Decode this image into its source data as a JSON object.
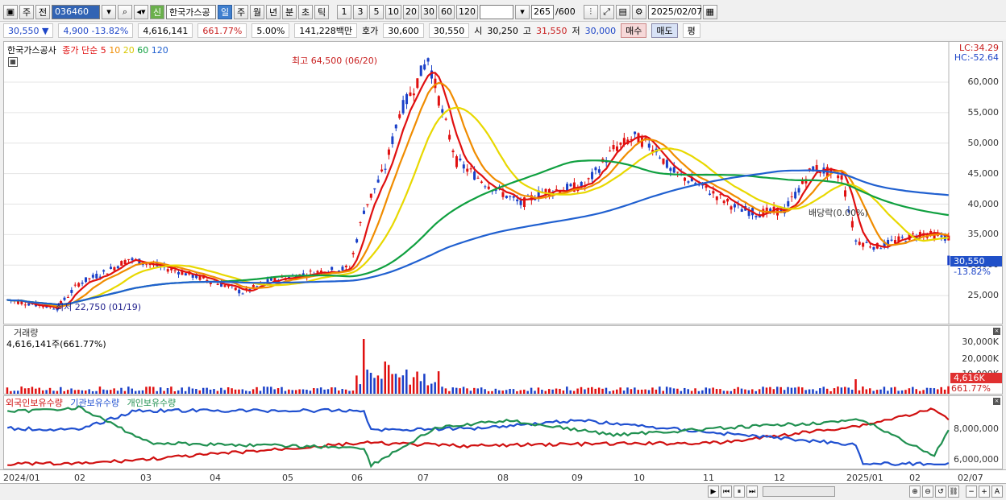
{
  "toolbar": {
    "period": "주",
    "prev": "전",
    "code": "036460",
    "name": "한국가스공",
    "credit": "신",
    "tabs": [
      "일",
      "주",
      "월",
      "년",
      "분",
      "초",
      "틱"
    ],
    "nums": [
      "1",
      "3",
      "5",
      "10",
      "20",
      "30",
      "60",
      "120"
    ],
    "count": "265",
    "count_total": "/600",
    "date": "2025/02/07"
  },
  "info": {
    "price": "30,550",
    "arrow": "▼",
    "change": "4,900",
    "rate": "-13.82%",
    "volume": "4,616,141",
    "vol_rate": "661.77%",
    "pct": "5.00%",
    "amount": "141,228백만",
    "ask_label": "호가",
    "ask1": "30,600",
    "ask2": "30,550",
    "open_label": "시",
    "open": "30,250",
    "high_label": "고",
    "high": "31,550",
    "low_label": "저",
    "low": "30,000",
    "buy": "매수",
    "sell": "매도",
    "eval": "평"
  },
  "price_panel": {
    "name": "한국가스공사",
    "legend_title": "종가 단순",
    "ma": [
      "5",
      "10",
      "20",
      "60",
      "120"
    ],
    "ma_colors": [
      "#e01010",
      "#f08c00",
      "#e8d800",
      "#10a040",
      "#2060d0"
    ],
    "lc": "LC:34.29",
    "hc": "HC:-52.64",
    "yticks": [
      "60,000",
      "55,000",
      "50,000",
      "45,000",
      "40,000",
      "35,000",
      "30,000",
      "25,000"
    ],
    "high_ann": "최고 64,500 (06/20)",
    "low_ann": "최저 22,750 (01/19)",
    "div_ann": "배당락(0.00%)",
    "cur_price": "30,550",
    "cur_rate": "-13.82%"
  },
  "volume_panel": {
    "title": "거래량",
    "value": "4,616,141주(661.77%)",
    "yticks": [
      "30,000K",
      "20,000K",
      "10,000K"
    ],
    "badge": "4,616K",
    "badge_rate": "661.77%"
  },
  "holding_panel": {
    "l1": "외국인보유수량",
    "l2": "기관보유수량",
    "l3": "개인보유수량",
    "colors": [
      "#d01010",
      "#2050d0",
      "#209050"
    ],
    "yticks": [
      "8,000,000",
      "6,000,000"
    ]
  },
  "xaxis": [
    "2024/01",
    "02",
    "03",
    "04",
    "05",
    "06",
    "07",
    "08",
    "09",
    "10",
    "11",
    "12",
    "2025/01",
    "02",
    "02/07"
  ],
  "chart_data": {
    "type": "candlestick",
    "series": [
      {
        "name": "종가 단순 5"
      },
      {
        "name": "10"
      },
      {
        "name": "20"
      },
      {
        "name": "60"
      },
      {
        "name": "120"
      }
    ],
    "ylim": [
      20000,
      66000
    ],
    "annotations": [
      "최고 64,500 (06/20)",
      "최저 22,750 (01/19)",
      "배당락(0.00%)"
    ],
    "last_close": 30550
  }
}
